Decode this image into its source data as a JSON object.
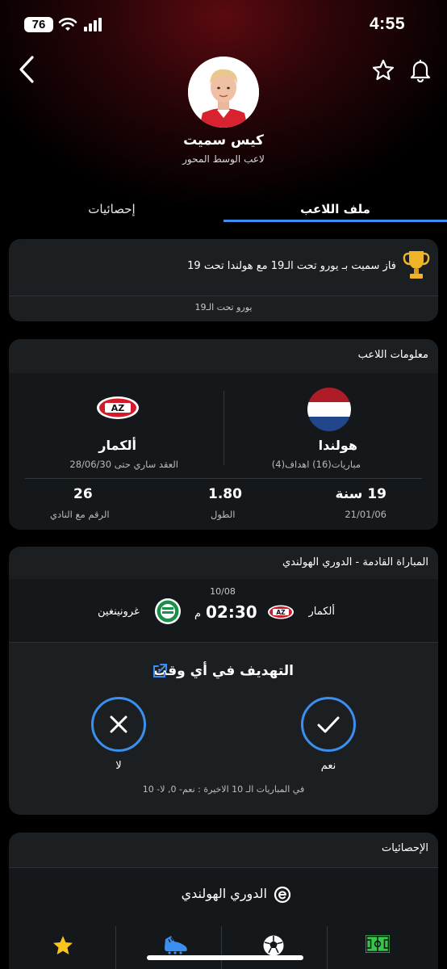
{
  "status_bar": {
    "battery": "76",
    "time": "4:55"
  },
  "player": {
    "name": "كيس سميت",
    "position": "لاعب الوسط المحور"
  },
  "tabs": [
    {
      "label": "ملف اللاعب",
      "active": true
    },
    {
      "label": "إحصائيات",
      "active": false
    }
  ],
  "trophy": {
    "text": "فاز سميت بـ يورو تحت الـ19 مع هولندا تحت 19",
    "competition": "يورو تحت الـ19"
  },
  "player_info": {
    "title": "معلومات اللاعب",
    "national_team": {
      "name": "هولندا",
      "sub": "مباريات(16) اهداف(4)"
    },
    "club": {
      "name": "ألكمار",
      "sub": "العقد ساري حتى 28/06/30"
    },
    "age": {
      "value": "19 سنة",
      "label": "21/01/06"
    },
    "height": {
      "value": "1.80",
      "label": "الطول"
    },
    "shirt": {
      "value": "26",
      "label": "الرقم مع النادي"
    }
  },
  "next_match": {
    "title": "المباراة القادمة - الدوري الهولندي",
    "date": "10/08",
    "time": "02:30",
    "ampm": "م",
    "home_team": "ألكمار",
    "away_team": "غرونينغين",
    "vote_title": "التهديف في أي وقت",
    "yes_label": "نعم",
    "no_label": "لا",
    "footer": "في المباريات الـ 10 الاخيرة : نعم- 0, لا- 10"
  },
  "stats": {
    "title": "الإحصائيات",
    "league": "الدوري الهولندي",
    "icons": [
      "pitch-icon",
      "ball-icon",
      "boot-icon",
      "star-icon"
    ]
  },
  "colors": {
    "accent": "#3b8ff0",
    "card": "#1c1f22",
    "card_body": "#15181b",
    "pitch_green": "#35c64a",
    "star_yellow": "#f7c51c",
    "flag_red": "#ae1c28",
    "flag_blue": "#21468b"
  }
}
